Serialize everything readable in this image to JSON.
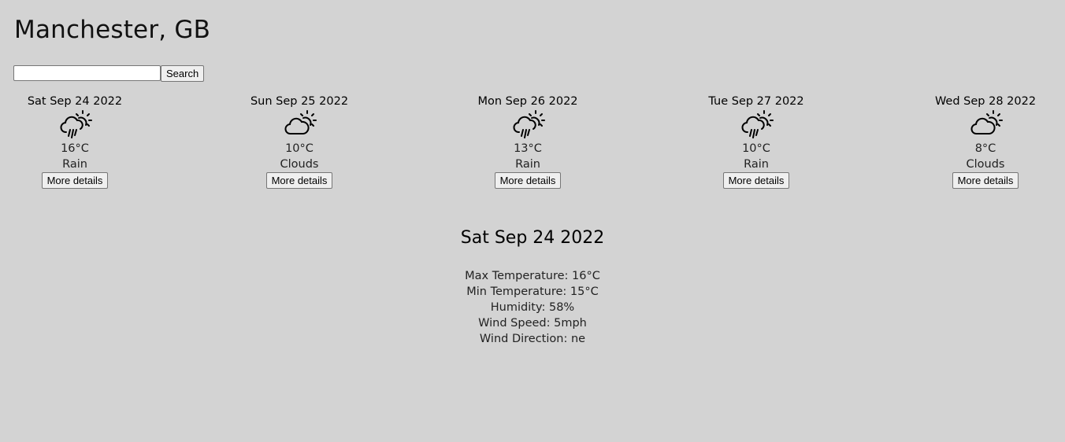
{
  "header": {
    "city": "Manchester, GB"
  },
  "search": {
    "value": "",
    "placeholder": "",
    "button_label": "Search"
  },
  "forecast": [
    {
      "date": "Sat Sep 24 2022",
      "temp": "16°C",
      "condition": "Rain",
      "icon": "rain-sun-icon",
      "button_label": "More details"
    },
    {
      "date": "Sun Sep 25 2022",
      "temp": "10°C",
      "condition": "Clouds",
      "icon": "cloud-sun-icon",
      "button_label": "More details"
    },
    {
      "date": "Mon Sep 26 2022",
      "temp": "13°C",
      "condition": "Rain",
      "icon": "rain-sun-icon",
      "button_label": "More details"
    },
    {
      "date": "Tue Sep 27 2022",
      "temp": "10°C",
      "condition": "Rain",
      "icon": "rain-sun-icon",
      "button_label": "More details"
    },
    {
      "date": "Wed Sep 28 2022",
      "temp": "8°C",
      "condition": "Clouds",
      "icon": "cloud-sun-icon",
      "button_label": "More details"
    }
  ],
  "details": {
    "date": "Sat Sep 24 2022",
    "max_temp": "Max Temperature: 16°C",
    "min_temp": "Min Temperature: 15°C",
    "humidity": "Humidity: 58%",
    "wind_speed": "Wind Speed: 5mph",
    "wind_direction": "Wind Direction: ne"
  },
  "colors": {
    "background": "#d3d3d3",
    "text": "#111111"
  }
}
